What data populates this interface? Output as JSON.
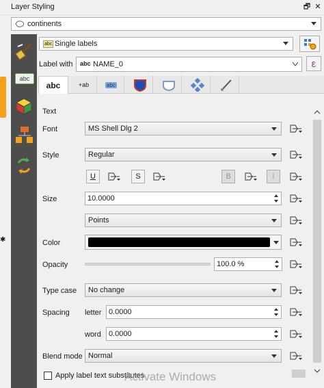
{
  "window": {
    "title": "Layer Styling",
    "float_glyph": "🗗",
    "close_glyph": "✕"
  },
  "layer_select": {
    "value": "continents"
  },
  "renderer": {
    "value": "Single labels",
    "icon_text": "abc"
  },
  "label_with": {
    "label": "Label with",
    "value": "NAME_0",
    "field_prefix": "abc",
    "expr_glyph": "ε"
  },
  "tabs": [
    {
      "name": "text",
      "text": "abc"
    },
    {
      "name": "formatting",
      "text": "+ab"
    },
    {
      "name": "buffer",
      "text": "abc"
    },
    {
      "name": "background",
      "text": ""
    },
    {
      "name": "shadow",
      "text": ""
    },
    {
      "name": "placement",
      "text": ""
    },
    {
      "name": "rendering",
      "text": ""
    }
  ],
  "sidebar_items": [
    "labels",
    "3d-view",
    "diagrams",
    "history"
  ],
  "sidebar_label_badge": "abc",
  "section": {
    "title": "Text"
  },
  "font": {
    "label": "Font",
    "value": "MS Shell Dlg 2"
  },
  "style": {
    "label": "Style",
    "value": "Regular"
  },
  "style_buttons": {
    "underline": "U",
    "strikeout": "S",
    "bold": "B",
    "italic": "I"
  },
  "size": {
    "label": "Size",
    "value": "10.0000",
    "unit": "Points"
  },
  "color": {
    "label": "Color",
    "swatch": "#000000"
  },
  "opacity": {
    "label": "Opacity",
    "value": "100.0 %",
    "fraction": 1.0
  },
  "type_case": {
    "label": "Type case",
    "value": "No change"
  },
  "spacing": {
    "label": "Spacing",
    "letter_label": "letter",
    "letter_value": "0.0000",
    "word_label": "word",
    "word_value": "0.0000"
  },
  "blend_mode": {
    "label": "Blend mode",
    "value": "Normal"
  },
  "substitutes": {
    "label": "Apply label text substitutes",
    "checked": false
  },
  "watermark": "Activate Windows",
  "colors": {
    "sidebar": "#4d4d4d",
    "accent": "#0078d7",
    "orange": "#f2a11b"
  }
}
